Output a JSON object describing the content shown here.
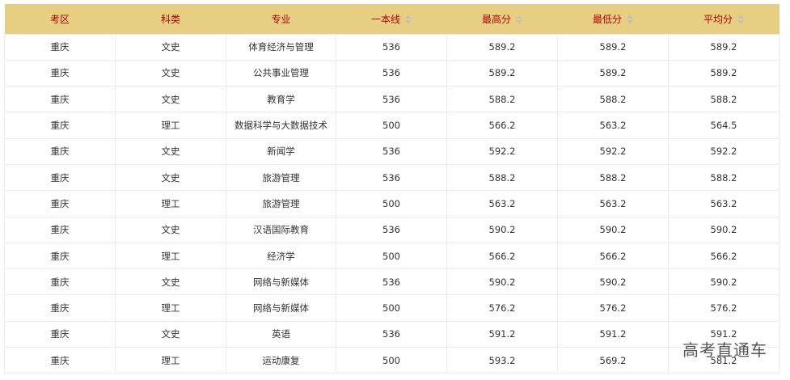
{
  "table": {
    "headers": [
      {
        "label": "考区",
        "sortable": false
      },
      {
        "label": "科类",
        "sortable": false
      },
      {
        "label": "专业",
        "sortable": false
      },
      {
        "label": "一本线",
        "sortable": true
      },
      {
        "label": "最高分",
        "sortable": true
      },
      {
        "label": "最低分",
        "sortable": true
      },
      {
        "label": "平均分",
        "sortable": true
      }
    ],
    "rows": [
      [
        "重庆",
        "文史",
        "体育经济与管理",
        "536",
        "589.2",
        "589.2",
        "589.2"
      ],
      [
        "重庆",
        "文史",
        "公共事业管理",
        "536",
        "589.2",
        "589.2",
        "589.2"
      ],
      [
        "重庆",
        "文史",
        "教育学",
        "536",
        "588.2",
        "588.2",
        "588.2"
      ],
      [
        "重庆",
        "理工",
        "数据科学与大数据技术",
        "500",
        "566.2",
        "563.2",
        "564.5"
      ],
      [
        "重庆",
        "文史",
        "新闻学",
        "536",
        "592.2",
        "592.2",
        "592.2"
      ],
      [
        "重庆",
        "文史",
        "旅游管理",
        "536",
        "588.2",
        "588.2",
        "588.2"
      ],
      [
        "重庆",
        "理工",
        "旅游管理",
        "500",
        "563.2",
        "563.2",
        "563.2"
      ],
      [
        "重庆",
        "文史",
        "汉语国际教育",
        "536",
        "590.2",
        "590.2",
        "590.2"
      ],
      [
        "重庆",
        "理工",
        "经济学",
        "500",
        "566.2",
        "566.2",
        "566.2"
      ],
      [
        "重庆",
        "文史",
        "网络与新媒体",
        "536",
        "590.2",
        "590.2",
        "590.2"
      ],
      [
        "重庆",
        "理工",
        "网络与新媒体",
        "500",
        "576.2",
        "576.2",
        "576.2"
      ],
      [
        "重庆",
        "文史",
        "英语",
        "536",
        "591.2",
        "591.2",
        "591.2"
      ],
      [
        "重庆",
        "理工",
        "运动康复",
        "500",
        "593.2",
        "569.2",
        "581.2"
      ]
    ]
  },
  "watermark": "高考直通车",
  "colors": {
    "header_bg": "#e6cf83",
    "header_text": "#b30000",
    "cell_text": "#333333",
    "border": "#ececec"
  }
}
